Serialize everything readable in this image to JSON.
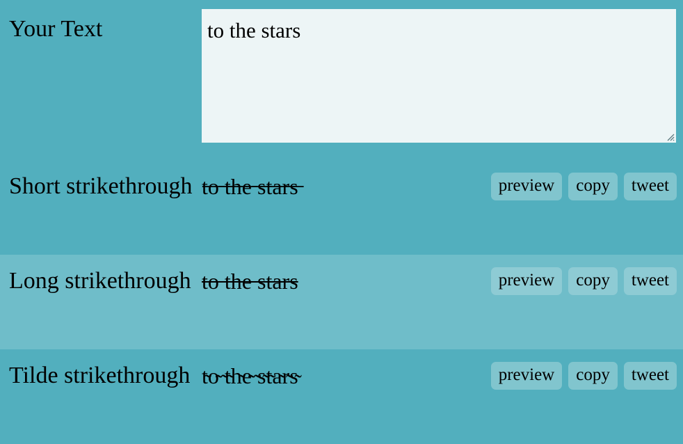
{
  "colors": {
    "page_bg": "#52AFBE",
    "row_alt_bg": "#6FBDC9",
    "textarea_bg": "#EDF5F6",
    "button_bg": "#81C5CE",
    "text": "#000000"
  },
  "input_row": {
    "label": "Your Text",
    "textarea": {
      "value": "to the stars",
      "placeholder": "",
      "resize_handle_icon": "resize-grip-icon"
    }
  },
  "results": [
    {
      "label": "Short strikethrough",
      "output": "t̶o̶ ̶t̶h̶e̶ ̶s̶t̶a̶r̶s̶",
      "style": "short",
      "buttons": [
        {
          "label": "preview",
          "name": "preview-button"
        },
        {
          "label": "copy",
          "name": "copy-button"
        },
        {
          "label": "tweet",
          "name": "tweet-button"
        }
      ]
    },
    {
      "label": "Long strikethrough",
      "output": "to the stars",
      "style": "long",
      "buttons": [
        {
          "label": "preview",
          "name": "preview-button"
        },
        {
          "label": "copy",
          "name": "copy-button"
        },
        {
          "label": "tweet",
          "name": "tweet-button"
        }
      ]
    },
    {
      "label": "Tilde strikethrough",
      "output": "t̴o̴ ̴t̴h̴e̴ ̴s̴t̴a̴r̴s̴",
      "style": "tilde",
      "buttons": [
        {
          "label": "preview",
          "name": "preview-button"
        },
        {
          "label": "copy",
          "name": "copy-button"
        },
        {
          "label": "tweet",
          "name": "tweet-button"
        }
      ]
    }
  ]
}
